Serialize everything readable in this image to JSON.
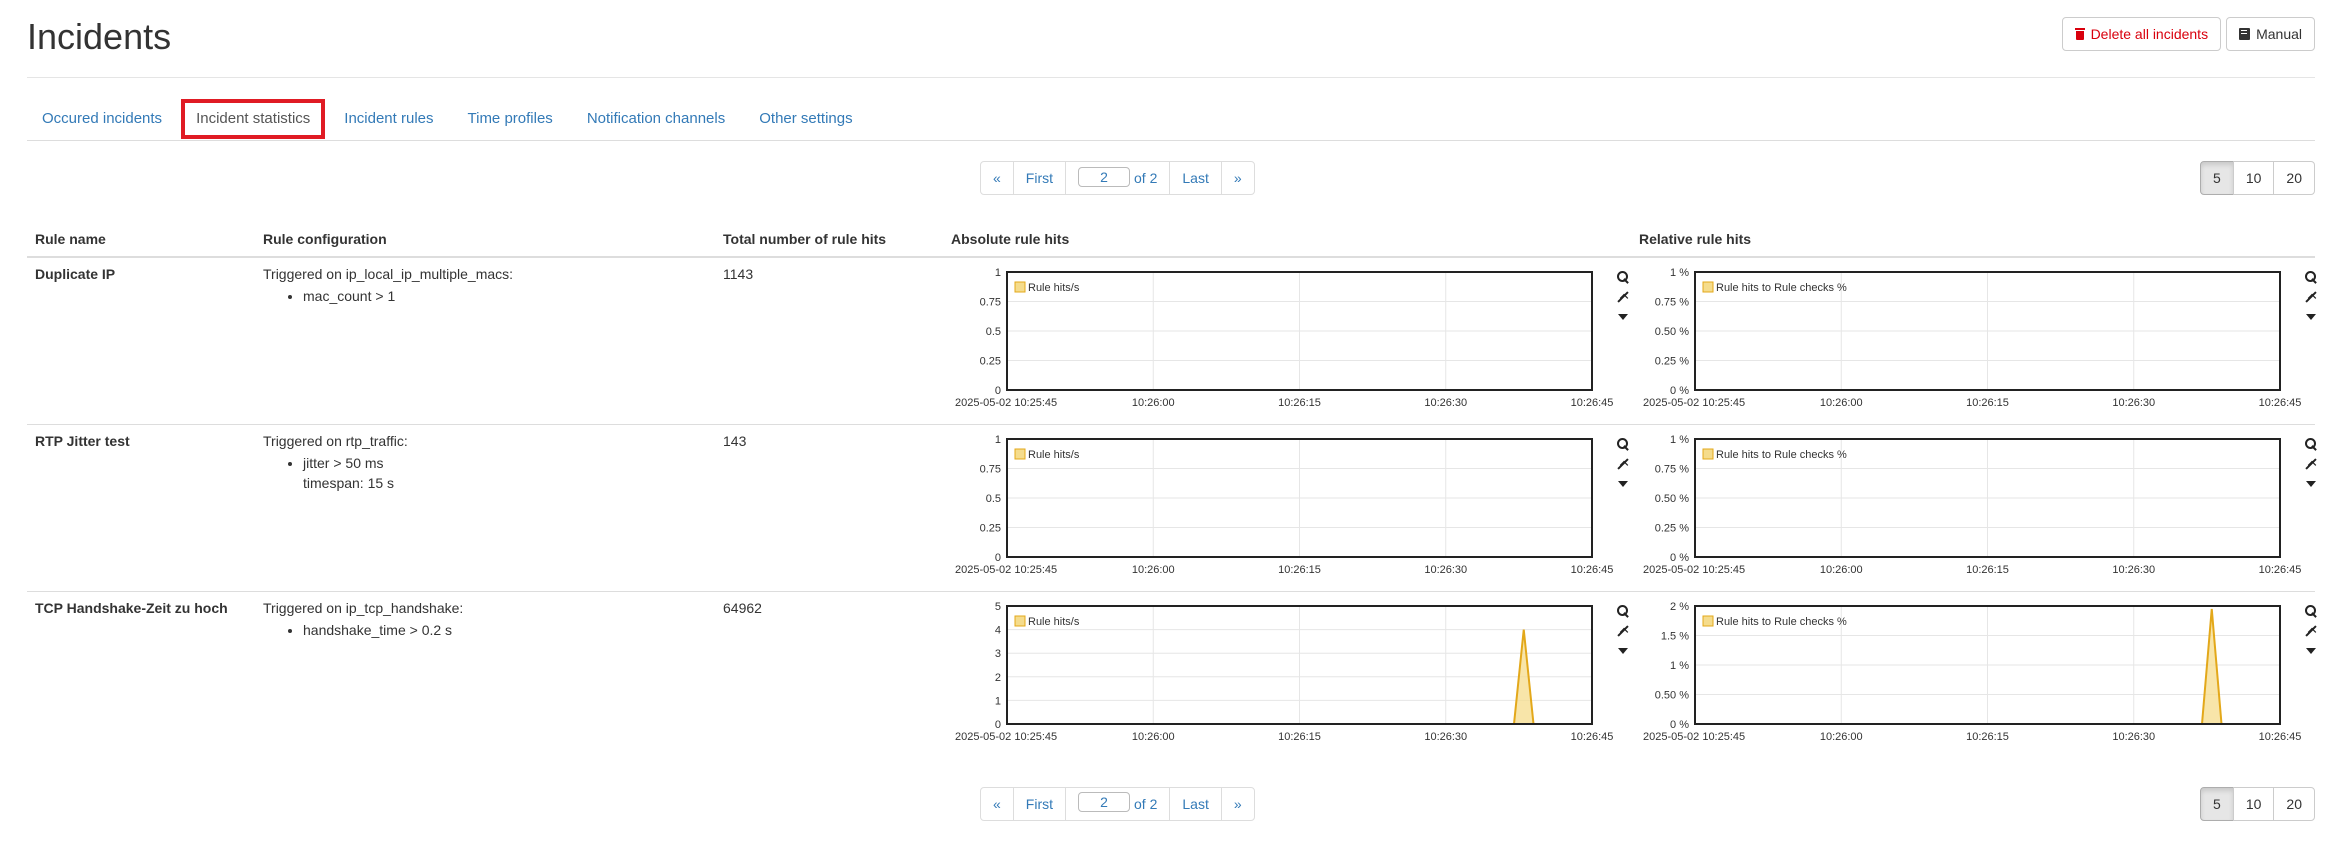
{
  "header": {
    "title": "Incidents",
    "delete_all_label": "Delete all incidents",
    "manual_label": "Manual"
  },
  "tabs": [
    {
      "label": "Occured incidents",
      "active": false
    },
    {
      "label": "Incident statistics",
      "active": true
    },
    {
      "label": "Incident rules",
      "active": false
    },
    {
      "label": "Time profiles",
      "active": false
    },
    {
      "label": "Notification channels",
      "active": false
    },
    {
      "label": "Other settings",
      "active": false
    }
  ],
  "pagination": {
    "prev": "«",
    "first": "First",
    "page": "2",
    "of_label": "of 2",
    "last": "Last",
    "next": "»",
    "page_sizes": [
      "5",
      "10",
      "20"
    ],
    "active_size": "5"
  },
  "table": {
    "headers": [
      "Rule name",
      "Rule configuration",
      "Total number of rule hits",
      "Absolute rule hits",
      "Relative rule hits"
    ],
    "rows": [
      {
        "name": "Duplicate IP",
        "config_trigger": "Triggered on ip_local_ip_multiple_macs:",
        "config_items": [
          "mac_count > 1"
        ],
        "config_extra": "",
        "total": "1143"
      },
      {
        "name": "RTP Jitter test",
        "config_trigger": "Triggered on rtp_traffic:",
        "config_items": [
          "jitter > 50 ms"
        ],
        "config_extra": "timespan: 15 s",
        "total": "143"
      },
      {
        "name": "TCP Handshake-Zeit zu hoch",
        "config_trigger": "Triggered on ip_tcp_handshake:",
        "config_items": [
          "handshake_time > 0.2 s"
        ],
        "config_extra": "",
        "total": "64962"
      }
    ]
  },
  "colors": {
    "series_line": "#e3a81a",
    "series_fill": "#f5dc8c",
    "link": "#337ab7",
    "active_tab_border": "#e01b24"
  },
  "chart_data": [
    {
      "type": "area",
      "row": 0,
      "panel": "absolute",
      "legend": "Rule hits/s",
      "x_ticks": [
        "2025-05-02 10:25:45",
        "10:26:00",
        "10:26:15",
        "10:26:30",
        "10:26:45"
      ],
      "y_ticks": [
        "0",
        "0.25",
        "0.5",
        "0.75",
        "1"
      ],
      "ylim": [
        0,
        1
      ],
      "x": [
        0,
        60
      ],
      "values": [
        0,
        0
      ]
    },
    {
      "type": "area",
      "row": 0,
      "panel": "relative",
      "legend": "Rule hits to Rule checks %",
      "x_ticks": [
        "2025-05-02 10:25:45",
        "10:26:00",
        "10:26:15",
        "10:26:30",
        "10:26:45"
      ],
      "y_ticks": [
        "0 %",
        "0.25 %",
        "0.50 %",
        "0.75 %",
        "1 %"
      ],
      "ylim": [
        0,
        1
      ],
      "x": [
        0,
        60
      ],
      "values": [
        0,
        0
      ]
    },
    {
      "type": "area",
      "row": 1,
      "panel": "absolute",
      "legend": "Rule hits/s",
      "x_ticks": [
        "2025-05-02 10:25:45",
        "10:26:00",
        "10:26:15",
        "10:26:30",
        "10:26:45"
      ],
      "y_ticks": [
        "0",
        "0.25",
        "0.5",
        "0.75",
        "1"
      ],
      "ylim": [
        0,
        1
      ],
      "x": [
        0,
        60
      ],
      "values": [
        0,
        0
      ]
    },
    {
      "type": "area",
      "row": 1,
      "panel": "relative",
      "legend": "Rule hits to Rule checks %",
      "x_ticks": [
        "2025-05-02 10:25:45",
        "10:26:00",
        "10:26:15",
        "10:26:30",
        "10:26:45"
      ],
      "y_ticks": [
        "0 %",
        "0.25 %",
        "0.50 %",
        "0.75 %",
        "1 %"
      ],
      "ylim": [
        0,
        1
      ],
      "x": [
        0,
        60
      ],
      "values": [
        0,
        0
      ]
    },
    {
      "type": "area",
      "row": 2,
      "panel": "absolute",
      "legend": "Rule hits/s",
      "x_ticks": [
        "2025-05-02 10:25:45",
        "10:26:00",
        "10:26:15",
        "10:26:30",
        "10:26:45"
      ],
      "y_ticks": [
        "0",
        "1",
        "2",
        "3",
        "4",
        "5"
      ],
      "ylim": [
        0,
        5
      ],
      "x": [
        0,
        52,
        53,
        54,
        60
      ],
      "values": [
        0,
        0,
        4,
        0,
        0
      ]
    },
    {
      "type": "area",
      "row": 2,
      "panel": "relative",
      "legend": "Rule hits to Rule checks %",
      "x_ticks": [
        "2025-05-02 10:25:45",
        "10:26:00",
        "10:26:15",
        "10:26:30",
        "10:26:45"
      ],
      "y_ticks": [
        "0 %",
        "0.50 %",
        "1 %",
        "1.5 %",
        "2 %"
      ],
      "ylim": [
        0,
        2
      ],
      "x": [
        0,
        52,
        53,
        54,
        60
      ],
      "values": [
        0,
        0,
        1.95,
        0,
        0
      ]
    }
  ]
}
